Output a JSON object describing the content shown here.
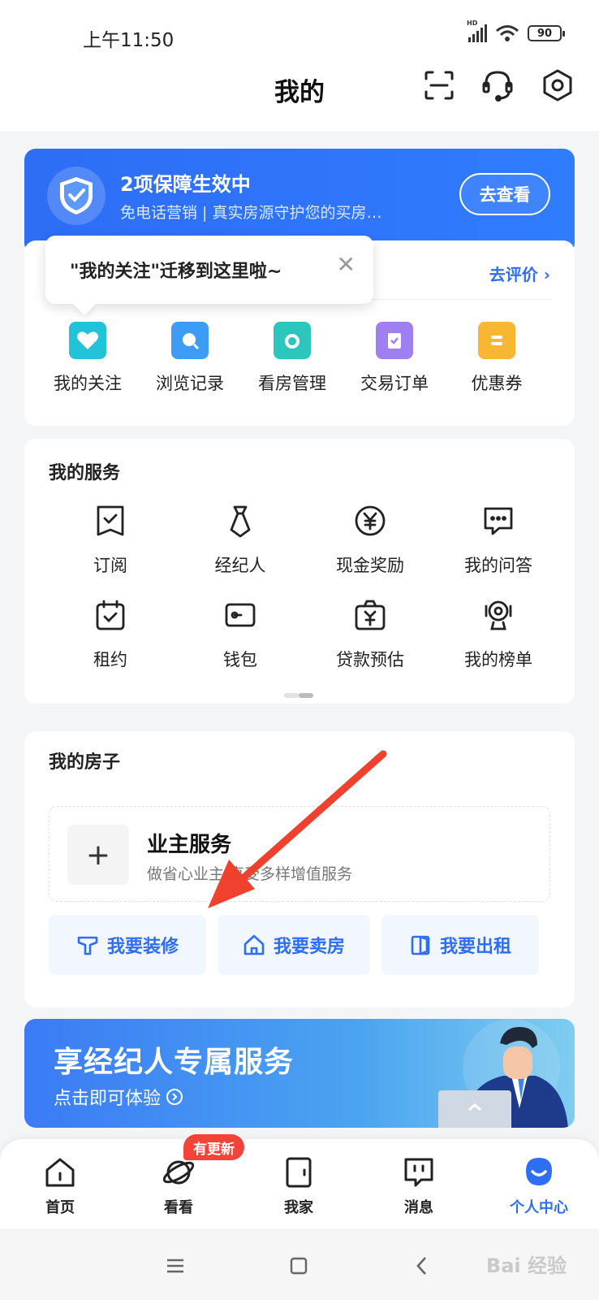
{
  "status_bar": {
    "time": "上午11:50",
    "network": "HD",
    "battery": "90"
  },
  "header": {
    "title": "我的"
  },
  "guarantee": {
    "title": "2项保障生效中",
    "subtitle": "免电话营销 | 真实房源守护您的买房…",
    "button": "去查看"
  },
  "tooltip": {
    "text": "\"我的关注\"迁移到这里啦~",
    "close": "✕"
  },
  "quick": {
    "rate_link": "去评价",
    "items": [
      {
        "label": "我的关注",
        "icon": "heart-house-icon",
        "color": "#22c3d8"
      },
      {
        "label": "浏览记录",
        "icon": "search-icon",
        "color": "#3d9cf5"
      },
      {
        "label": "看房管理",
        "icon": "folder-icon",
        "color": "#2dc6bd"
      },
      {
        "label": "交易订单",
        "icon": "clipboard-check-icon",
        "color": "#a07ff0"
      },
      {
        "label": "优惠券",
        "icon": "coupon-icon",
        "color": "#f7b733"
      }
    ]
  },
  "services": {
    "title": "我的服务",
    "items": [
      {
        "label": "订阅",
        "icon": "bookmark-check-icon"
      },
      {
        "label": "经纪人",
        "icon": "tie-icon"
      },
      {
        "label": "现金奖励",
        "icon": "yuan-coin-icon"
      },
      {
        "label": "我的问答",
        "icon": "chat-bubble-icon"
      },
      {
        "label": "租约",
        "icon": "calendar-check-icon"
      },
      {
        "label": "钱包",
        "icon": "wallet-icon"
      },
      {
        "label": "贷款预估",
        "icon": "yuan-bag-icon"
      },
      {
        "label": "我的榜单",
        "icon": "trophy-icon"
      }
    ]
  },
  "house": {
    "title": "我的房子",
    "owner_title": "业主服务",
    "owner_sub": "做省心业主 享受多样增值服务",
    "buttons": [
      {
        "label": "我要装修",
        "icon": "paint-roller-icon"
      },
      {
        "label": "我要卖房",
        "icon": "house-icon"
      },
      {
        "label": "我要出租",
        "icon": "door-icon"
      }
    ]
  },
  "promo": {
    "title": "享经纪人专属服务",
    "subtitle": "点击即可体验"
  },
  "tabs": {
    "badge": "有更新",
    "items": [
      {
        "label": "首页",
        "icon": "home-icon",
        "active": false
      },
      {
        "label": "看看",
        "icon": "planet-icon",
        "active": false
      },
      {
        "label": "我家",
        "icon": "door-home-icon",
        "active": false
      },
      {
        "label": "消息",
        "icon": "message-icon",
        "active": false
      },
      {
        "label": "个人中心",
        "icon": "profile-face-icon",
        "active": true
      }
    ]
  },
  "colors": {
    "accent": "#2d6ef5",
    "badge": "#f4443a",
    "arrow": "#f0402e"
  },
  "watermark": "Bai 经验"
}
